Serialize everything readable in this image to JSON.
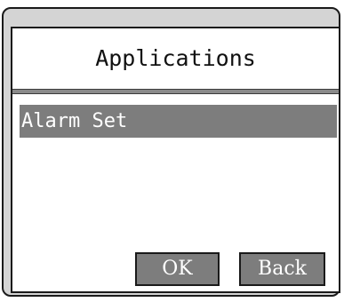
{
  "screen": {
    "title": "Applications"
  },
  "menu": {
    "items": [
      {
        "label": "Alarm Set",
        "selected": true
      }
    ]
  },
  "softkeys": {
    "ok_label": "OK",
    "back_label": "Back"
  },
  "colors": {
    "selection": "#7d7d7d",
    "button": "#7d7d7d",
    "frame": "#d4d4d4",
    "screen": "#ffffff"
  }
}
